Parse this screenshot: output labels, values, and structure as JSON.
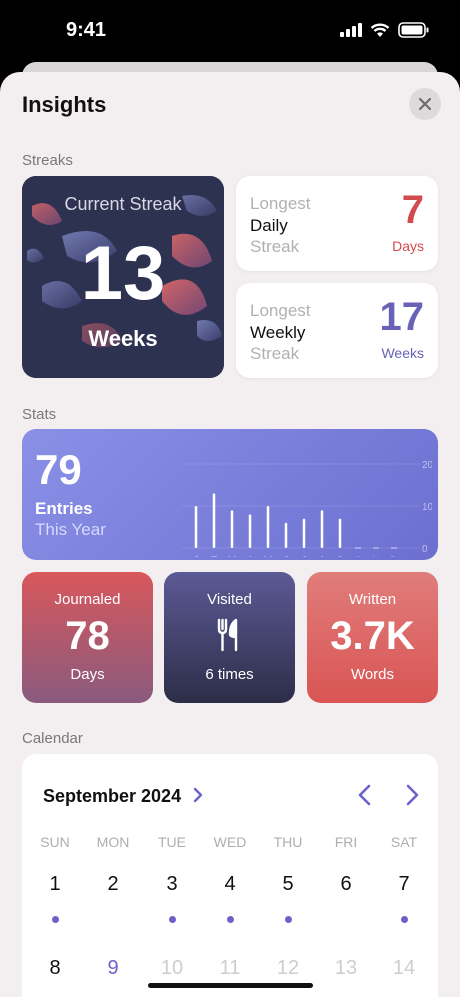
{
  "status": {
    "time": "9:41"
  },
  "header": {
    "title": "Insights"
  },
  "sections": {
    "streaks": "Streaks",
    "stats": "Stats",
    "calendar": "Calendar"
  },
  "current_streak": {
    "label": "Current Streak",
    "value": "13",
    "unit": "Weeks"
  },
  "daily_streak": {
    "line1": "Longest",
    "line2": "Daily",
    "line3": "Streak",
    "value": "7",
    "unit": "Days",
    "color": "#d24b4e"
  },
  "weekly_streak": {
    "line1": "Longest",
    "line2": "Weekly",
    "line3": "Streak",
    "value": "17",
    "unit": "Weeks",
    "color": "#6a62b6"
  },
  "entries": {
    "value": "79",
    "label": "Entries",
    "sub": "This Year",
    "chart_data": {
      "type": "bar",
      "categories": [
        "J",
        "F",
        "M",
        "A",
        "M",
        "J",
        "J",
        "A",
        "S",
        "O",
        "N",
        "D"
      ],
      "values": [
        10,
        13,
        9,
        8,
        10,
        6,
        7,
        9,
        7,
        0,
        0,
        0
      ],
      "ylim": [
        0,
        20
      ],
      "yticks": [
        "20",
        "10",
        "0"
      ]
    }
  },
  "stats": [
    {
      "label": "Journaled",
      "value": "78",
      "unit": "Days"
    },
    {
      "label": "Visited",
      "icon": "fork-knife-icon",
      "unit": "6 times"
    },
    {
      "label": "Written",
      "value": "3.7K",
      "unit": "Words"
    }
  ],
  "calendar": {
    "month": "September 2024",
    "weekdays": [
      "SUN",
      "MON",
      "TUE",
      "WED",
      "THU",
      "FRI",
      "SAT"
    ],
    "week1": [
      "1",
      "2",
      "3",
      "4",
      "5",
      "6",
      "7"
    ],
    "week1_dots": [
      true,
      false,
      true,
      true,
      true,
      false,
      true
    ],
    "week2": [
      "8",
      "9",
      "10",
      "11",
      "12",
      "13",
      "14"
    ],
    "today_index": 1
  },
  "colors": {
    "accent": "#6a62c9",
    "red": "#d24b4e",
    "purple": "#6a62b6"
  }
}
